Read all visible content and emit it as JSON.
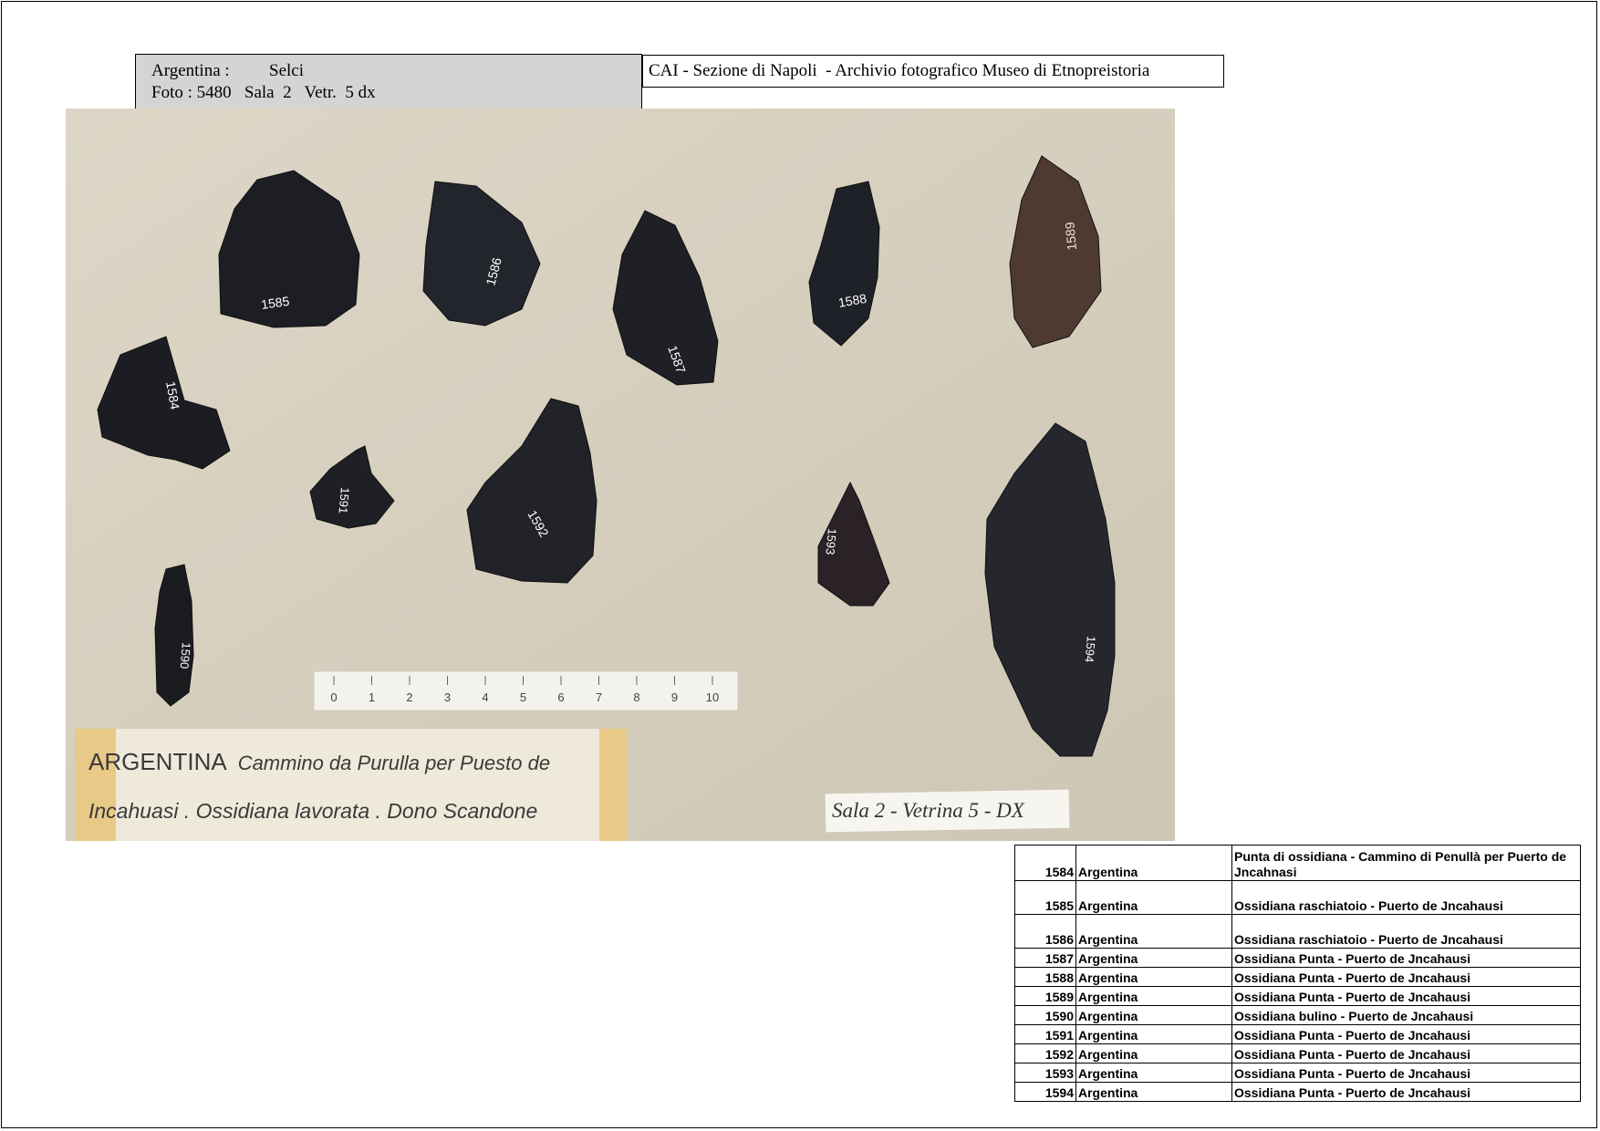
{
  "header": {
    "country": "Argentina :",
    "material": "Selci",
    "photo_line": "Foto : 5480   Sala  2   Vetr.  5 dx",
    "archive_title": "CAI - Sezione di Napoli  - Archivio fotografico Museo di Etnopreistoria"
  },
  "photo": {
    "artifacts": [
      {
        "number": "1584",
        "color": "#1c1d22"
      },
      {
        "number": "1585",
        "color": "#1d1e24"
      },
      {
        "number": "1586",
        "color": "#23252c"
      },
      {
        "number": "1587",
        "color": "#1e2026"
      },
      {
        "number": "1588",
        "color": "#1f2128"
      },
      {
        "number": "1589",
        "color": "#4e3a33"
      },
      {
        "number": "1590",
        "color": "#1b1c20"
      },
      {
        "number": "1591",
        "color": "#1f2025"
      },
      {
        "number": "1592",
        "color": "#222329"
      },
      {
        "number": "1593",
        "color": "#2a2226"
      },
      {
        "number": "1594",
        "color": "#25272d"
      }
    ],
    "scale_ticks": [
      "0",
      "1",
      "2",
      "3",
      "4",
      "5",
      "6",
      "7",
      "8",
      "9",
      "10"
    ],
    "label_line1_prefix": "ARGENTINA",
    "label_line1_rest": "Cammino da Purulla per Puesto de",
    "label_line2": "Incahuasi . Ossidiana lavorata . Dono Scandone",
    "sala_label": "Sala 2 - Vetrina 5 - DX"
  },
  "catalog": [
    {
      "num": "1584",
      "country": "Argentina",
      "desc": "Punta di ossidiana - Cammino di Penullà per Puerto de Jncahnasi"
    },
    {
      "num": "1585",
      "country": "Argentina",
      "desc": "Ossidiana raschiatoio - Puerto de  Jncahausi"
    },
    {
      "num": "1586",
      "country": "Argentina",
      "desc": "Ossidiana raschiatoio - Puerto de  Jncahausi"
    },
    {
      "num": "1587",
      "country": "Argentina",
      "desc": "Ossidiana  Punta - Puerto de  Jncahausi"
    },
    {
      "num": "1588",
      "country": "Argentina",
      "desc": "Ossidiana  Punta - Puerto de  Jncahausi"
    },
    {
      "num": "1589",
      "country": "Argentina",
      "desc": "Ossidiana  Punta - Puerto de  Jncahausi"
    },
    {
      "num": "1590",
      "country": "Argentina",
      "desc": "Ossidiana  bulino - Puerto de  Jncahausi"
    },
    {
      "num": "1591",
      "country": "Argentina",
      "desc": "Ossidiana  Punta - Puerto de  Jncahausi"
    },
    {
      "num": "1592",
      "country": "Argentina",
      "desc": "Ossidiana  Punta - Puerto de  Jncahausi"
    },
    {
      "num": "1593",
      "country": "Argentina",
      "desc": "Ossidiana  Punta - Puerto de  Jncahausi"
    },
    {
      "num": "1594",
      "country": "Argentina",
      "desc": "Ossidiana  Punta - Puerto de  Jncahausi"
    }
  ]
}
